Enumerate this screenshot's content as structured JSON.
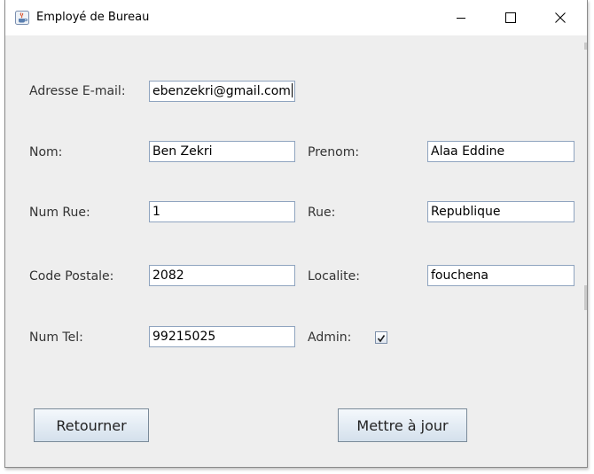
{
  "window": {
    "title": "Employé de Bureau",
    "icon": "java-cup-icon"
  },
  "controls": {
    "minimize": "minimize-icon",
    "maximize": "maximize-icon",
    "close": "close-icon"
  },
  "form": {
    "email_label": "Adresse E-mail:",
    "email_value": "ebenzekri@gmail.com",
    "nom_label": "Nom:",
    "nom_value": "Ben Zekri",
    "prenom_label": "Prenom:",
    "prenom_value": "Alaa Eddine",
    "numrue_label": "Num Rue:",
    "numrue_value": "1",
    "rue_label": "Rue:",
    "rue_value": "Republique",
    "cp_label": "Code Postale:",
    "cp_value": "2082",
    "localite_label": "Localite:",
    "localite_value": "fouchena",
    "tel_label": "Num Tel:",
    "tel_value": "99215025",
    "admin_label": "Admin:",
    "admin_checked": true
  },
  "buttons": {
    "back_label": "Retourner",
    "update_label": "Mettre à jour"
  }
}
